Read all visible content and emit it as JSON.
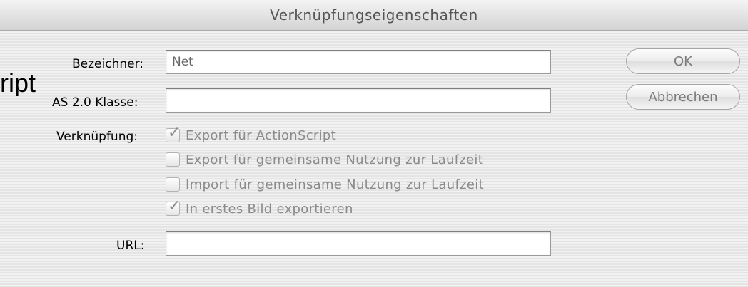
{
  "window": {
    "title": "Verknüpfungseigenschaften"
  },
  "background_fragment": "ript",
  "form": {
    "identifier": {
      "label": "Bezeichner:",
      "value": "Net"
    },
    "as2_class": {
      "label": "AS 2.0 Klasse:",
      "value": ""
    },
    "linkage": {
      "label": "Verknüpfung:",
      "options": [
        {
          "label": "Export für ActionScript",
          "checked": true
        },
        {
          "label": "Export für gemeinsame Nutzung zur Laufzeit",
          "checked": false
        },
        {
          "label": "Import für gemeinsame Nutzung zur Laufzeit",
          "checked": false
        },
        {
          "label": "In erstes Bild exportieren",
          "checked": true
        }
      ]
    },
    "url": {
      "label": "URL:",
      "value": ""
    }
  },
  "buttons": {
    "ok": "OK",
    "cancel": "Abbrechen"
  },
  "colors": {
    "background": "#ececec",
    "disabled_text": "#8a8a8a"
  }
}
